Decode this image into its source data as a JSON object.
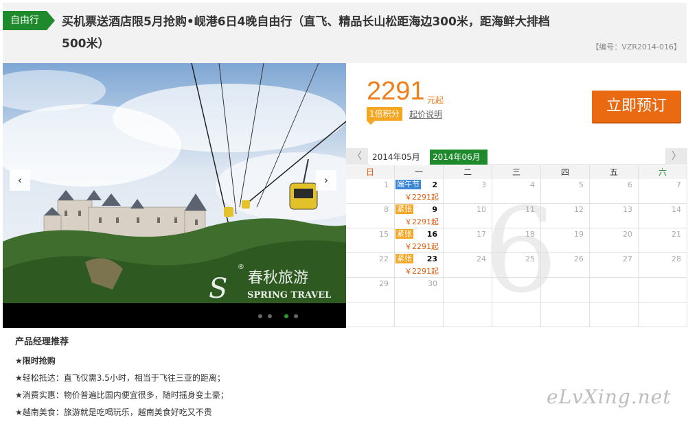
{
  "header": {
    "tag": "自由行",
    "title": "买机票送酒店限5月抢购•岘港6日4晚自由行（直飞、精品长山松距海边300米，距海鲜大排档500米）",
    "code": "【编号：VZR2014-016】"
  },
  "gallery": {
    "prev_icon": "‹",
    "next_icon": "›",
    "logo_text": "春秋旅游",
    "logo_sub": "SPRING TRAVEL",
    "logo_registered": "®",
    "active_dot": 2
  },
  "price": {
    "value": "2291",
    "unit": "元起",
    "points_badge": "1倍积分",
    "note_link": "起价说明",
    "book_button": "立即预订"
  },
  "calendar": {
    "prev_arrow": "〈",
    "next_arrow": "〉",
    "month_a": "2014年05月",
    "month_b": "2014年06月",
    "big_month_digit": "6",
    "weekdays": [
      "日",
      "一",
      "二",
      "三",
      "四",
      "五",
      "六"
    ],
    "rows": [
      [
        {
          "d": "1"
        },
        {
          "d": "2",
          "tag": "端午节",
          "tagType": "hol",
          "price": "￥2291起"
        },
        {
          "d": "3"
        },
        {
          "d": "4"
        },
        {
          "d": "5"
        },
        {
          "d": "6"
        },
        {
          "d": "7"
        }
      ],
      [
        {
          "d": "8"
        },
        {
          "d": "9",
          "tag": "紧张",
          "tagType": "tight",
          "price": "￥2291起"
        },
        {
          "d": "10"
        },
        {
          "d": "11"
        },
        {
          "d": "12"
        },
        {
          "d": "13"
        },
        {
          "d": "14"
        }
      ],
      [
        {
          "d": "15"
        },
        {
          "d": "16",
          "tag": "紧张",
          "tagType": "tight",
          "price": "￥2291起"
        },
        {
          "d": "17"
        },
        {
          "d": "18"
        },
        {
          "d": "19"
        },
        {
          "d": "20"
        },
        {
          "d": "21"
        }
      ],
      [
        {
          "d": "22"
        },
        {
          "d": "23",
          "tag": "紧张",
          "tagType": "tight",
          "price": "￥2291起"
        },
        {
          "d": "24"
        },
        {
          "d": "25"
        },
        {
          "d": "26"
        },
        {
          "d": "27"
        },
        {
          "d": "28"
        }
      ],
      [
        {
          "d": "29"
        },
        {
          "d": "30"
        },
        {
          "d": ""
        },
        {
          "d": ""
        },
        {
          "d": ""
        },
        {
          "d": ""
        },
        {
          "d": ""
        }
      ],
      [
        {
          "d": ""
        },
        {
          "d": ""
        },
        {
          "d": ""
        },
        {
          "d": ""
        },
        {
          "d": ""
        },
        {
          "d": ""
        },
        {
          "d": ""
        }
      ]
    ]
  },
  "recommend": {
    "title": "产品经理推荐",
    "lines": [
      "★限时抢购",
      "★轻松抵达：直飞仅需3.5小时，相当于飞往三亚的距离；",
      "★消费实惠：物价普遍比国内便宜很多，随时摇身变土豪；",
      "★越南美食：旅游就是吃喝玩乐，越南美食好吃又不贵"
    ]
  },
  "watermark": "eLvXing.net",
  "colors": {
    "brand_green": "#1e8a2c",
    "price_orange": "#f07e1b",
    "book_orange": "#ea6a12",
    "tight_badge": "#f5a623",
    "holiday_badge": "#3a86d8"
  }
}
